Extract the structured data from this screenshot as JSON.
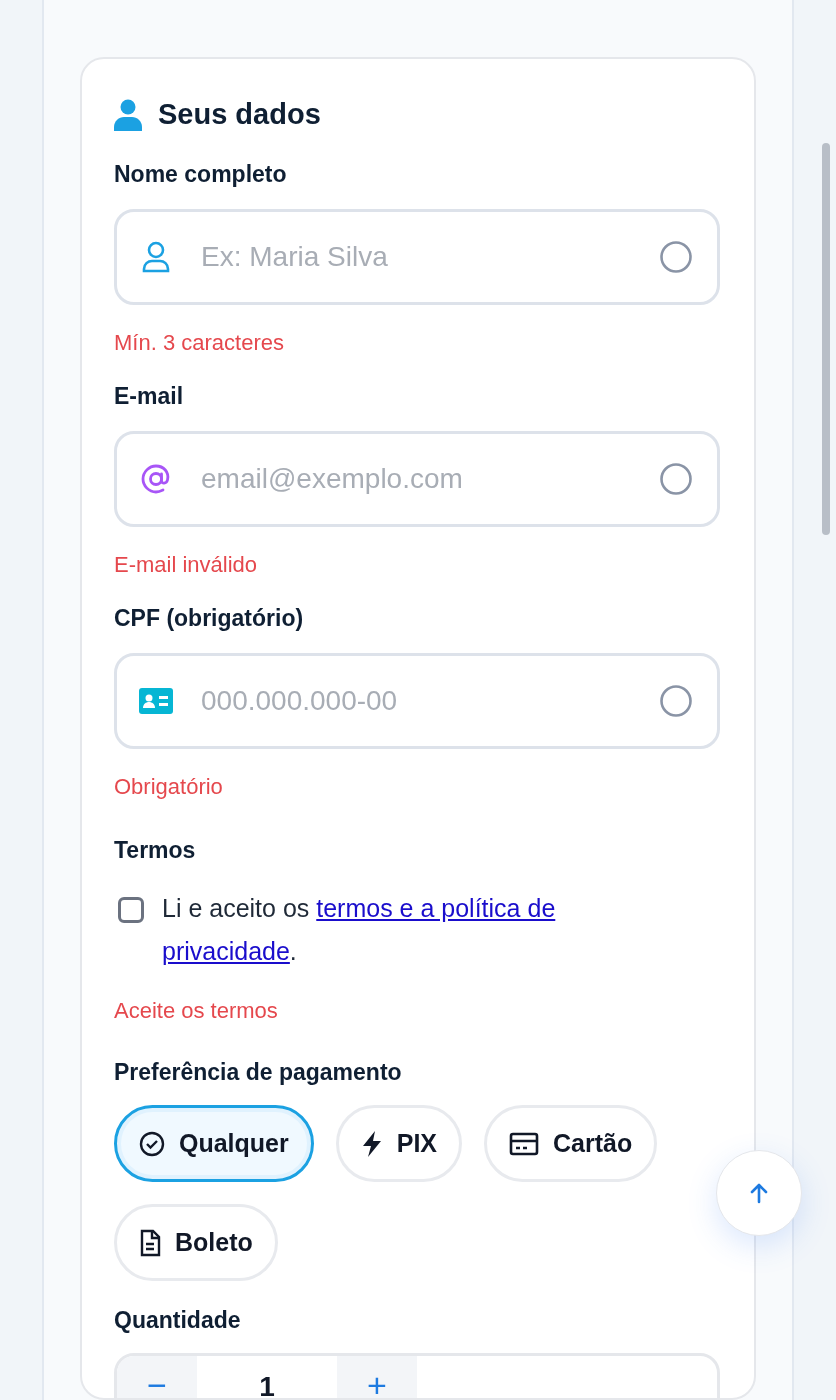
{
  "section": {
    "title": "Seus dados"
  },
  "fields": [
    {
      "label": "Nome completo",
      "kind": "person",
      "placeholder": "Ex: Maria Silva",
      "error": "Mín. 3 caracteres"
    },
    {
      "label": "E-mail",
      "kind": "at",
      "placeholder": "email@exemplo.com",
      "error": "E-mail inválido"
    },
    {
      "label": "CPF (obrigatório)",
      "kind": "idcard",
      "placeholder": "000.000.000-00",
      "error": "Obrigatório"
    }
  ],
  "terms": {
    "label": "Termos",
    "checked": false,
    "text_before": "Li e aceito os ",
    "link_lines": [
      "termos e a política de",
      "privacidade"
    ],
    "text_after": ".",
    "error": "Aceite os termos"
  },
  "payment": {
    "label": "Preferência de pagamento",
    "options": [
      {
        "label": "Qualquer",
        "kind": "any",
        "selected": true
      },
      {
        "label": "PIX",
        "kind": "bolt",
        "selected": false
      },
      {
        "label": "Cartão",
        "kind": "card",
        "selected": false
      },
      {
        "label": "Boleto",
        "kind": "doc",
        "selected": false
      }
    ]
  },
  "quantity": {
    "label": "Quantidade",
    "minus": "−",
    "value": "1",
    "plus": "+"
  }
}
